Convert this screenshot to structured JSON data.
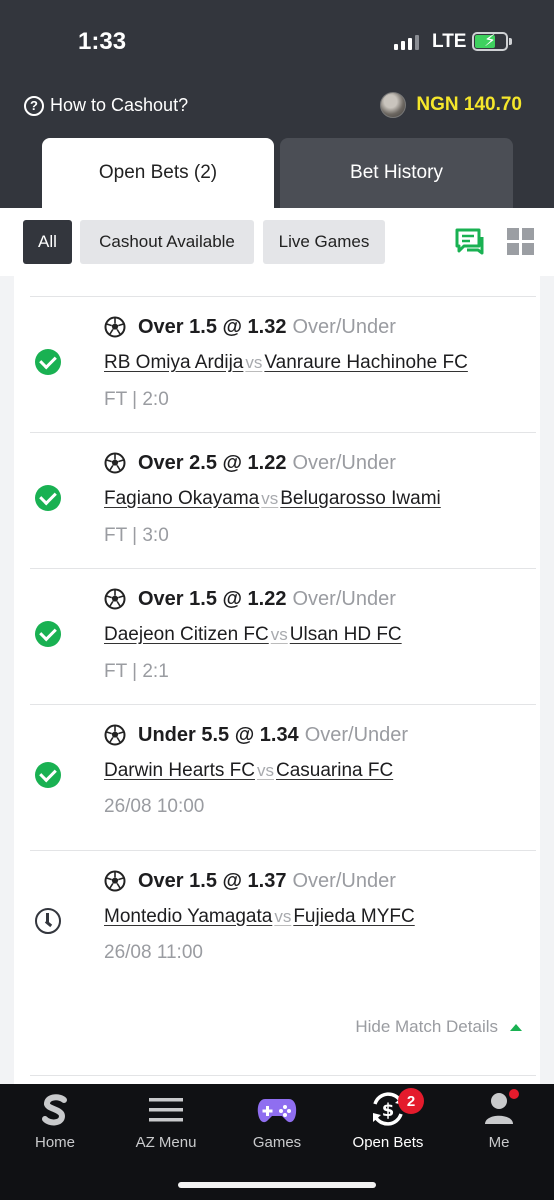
{
  "status_bar": {
    "time": "1:33",
    "network": "LTE"
  },
  "header": {
    "help_label": "How to Cashout?",
    "balance": "NGN 140.70"
  },
  "tabs": {
    "open_bets": "Open Bets (2)",
    "bet_history": "Bet History"
  },
  "filters": {
    "all": "All",
    "cashout": "Cashout Available",
    "live": "Live Games"
  },
  "bets": [
    {
      "pick": "Over 1.5 @ 1.32",
      "market": "Over/Under",
      "home": "RB Omiya Ardija",
      "vs": "vs",
      "away": "Vanraure Hachinohe FC",
      "result": "FT | 2:0",
      "status": "won"
    },
    {
      "pick": "Over 2.5 @ 1.22",
      "market": "Over/Under",
      "home": "Fagiano Okayama",
      "vs": "vs",
      "away": "Belugarosso Iwami",
      "result": "FT | 3:0",
      "status": "won"
    },
    {
      "pick": "Over 1.5 @ 1.22",
      "market": "Over/Under",
      "home": "Daejeon Citizen FC",
      "vs": "vs",
      "away": "Ulsan HD FC",
      "result": "FT | 2:1",
      "status": "won"
    },
    {
      "pick": "Under 5.5 @ 1.34",
      "market": "Over/Under",
      "home": "Darwin Hearts FC",
      "vs": "vs",
      "away": "Casuarina FC",
      "result": "26/08 10:00",
      "status": "won"
    },
    {
      "pick": "Over 1.5 @ 1.37",
      "market": "Over/Under",
      "home": "Montedio Yamagata",
      "vs": "vs",
      "away": "Fujieda MYFC",
      "result": "26/08 11:00",
      "status": "pending"
    }
  ],
  "hide_details_label": "Hide Match Details",
  "bottom_nav": {
    "home": "Home",
    "az_menu": "AZ Menu",
    "games": "Games",
    "open_bets": "Open Bets",
    "open_bets_badge": "2",
    "me": "Me"
  },
  "colors": {
    "accent_green": "#19b152",
    "balance_yellow": "#f5e62b",
    "header_bg": "#33363d",
    "badge_red": "#e41b2c"
  }
}
